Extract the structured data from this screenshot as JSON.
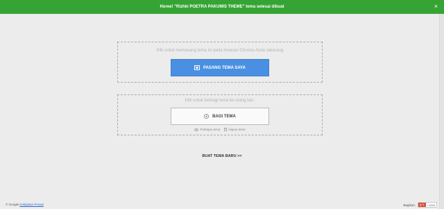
{
  "banner": {
    "message": "Horee! \"Rizhki POETRA PAKUMIS THEME\" tema selesai dibuat",
    "close_label": "×"
  },
  "install": {
    "caption": "Klik untuk memasang tema ini pada browser Chrome Anda sekarang",
    "button_label": "PASANG TEMA SAYA"
  },
  "share": {
    "caption": "Klik untuk berbagi tema ke orang lain.",
    "button_label": "BAGI TEMA",
    "preview_label": "Pratinjau tema",
    "delete_label": "Hapus tema"
  },
  "new_theme_label": "BUAT TEMA BARU >>",
  "footer": {
    "copyright": "© Google",
    "privacy_label": "Kebijakan Privasi",
    "share_label": "Bagikan:",
    "gplus_label": "g+1",
    "gplus_count": "+1590"
  },
  "colors": {
    "banner": "#36a434",
    "primary_button": "#4a90e2",
    "background": "#ececec"
  }
}
